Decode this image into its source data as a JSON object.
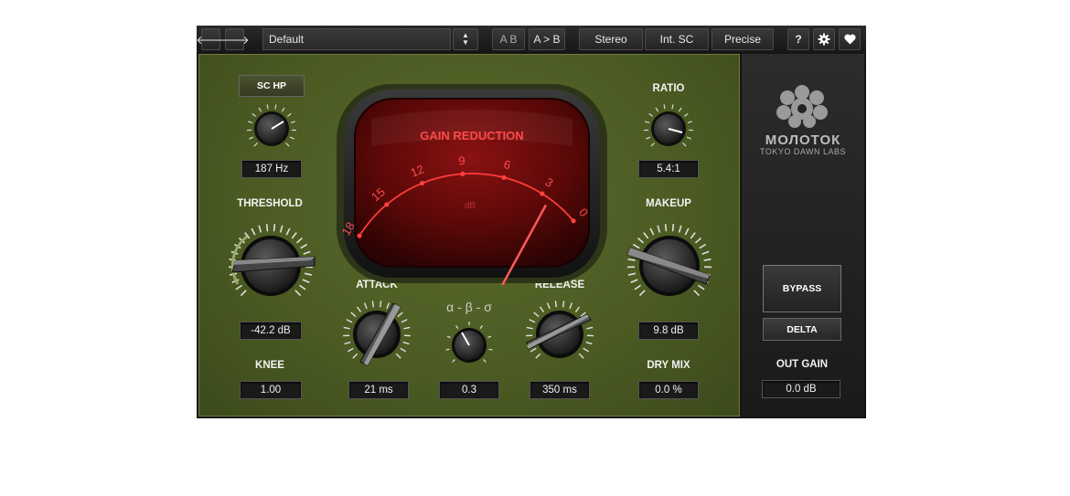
{
  "toolbar": {
    "back": "🡐",
    "forward": "🡒",
    "preset": "Default",
    "ab": "A B",
    "a_to_b": "A > B",
    "stereo": "Stereo",
    "int_sc": "Int. SC",
    "precise": "Precise",
    "help": "?",
    "settings_icon": "gear-icon",
    "favorite_icon": "heart-icon"
  },
  "meter": {
    "title": "GAIN REDUCTION",
    "unit": "dB",
    "scale": [
      "18",
      "15",
      "12",
      "9",
      "6",
      "3",
      "0"
    ],
    "reading_db": 2.3
  },
  "controls": {
    "sc_hp_button": "SC HP",
    "sc_hp_value": "187 Hz",
    "threshold_label": "THRESHOLD",
    "threshold_value": "-42.2 dB",
    "knee_label": "KNEE",
    "knee_value": "1.00",
    "attack_label": "ATTACK",
    "attack_value": "21 ms",
    "alpha_beta_label": "α - β - σ",
    "alpha_beta_value": "0.3",
    "release_label": "RELEASE",
    "release_value": "350 ms",
    "ratio_label": "RATIO",
    "ratio_value": "5.4:1",
    "makeup_label": "MAKEUP",
    "makeup_value": "9.8 dB",
    "drymix_label": "DRY MIX",
    "drymix_value": "0.0 %"
  },
  "sidebar": {
    "brand": "МОЛОТОК",
    "vendor": "TOKYO DAWN LABS",
    "bypass": "BYPASS",
    "delta": "DELTA",
    "out_gain_label": "OUT GAIN",
    "out_gain_value": "0.0 dB"
  },
  "colors": {
    "panel_green": "#4a5a22",
    "meter_red": "#ff3030",
    "meter_bg": "#5a0808"
  }
}
